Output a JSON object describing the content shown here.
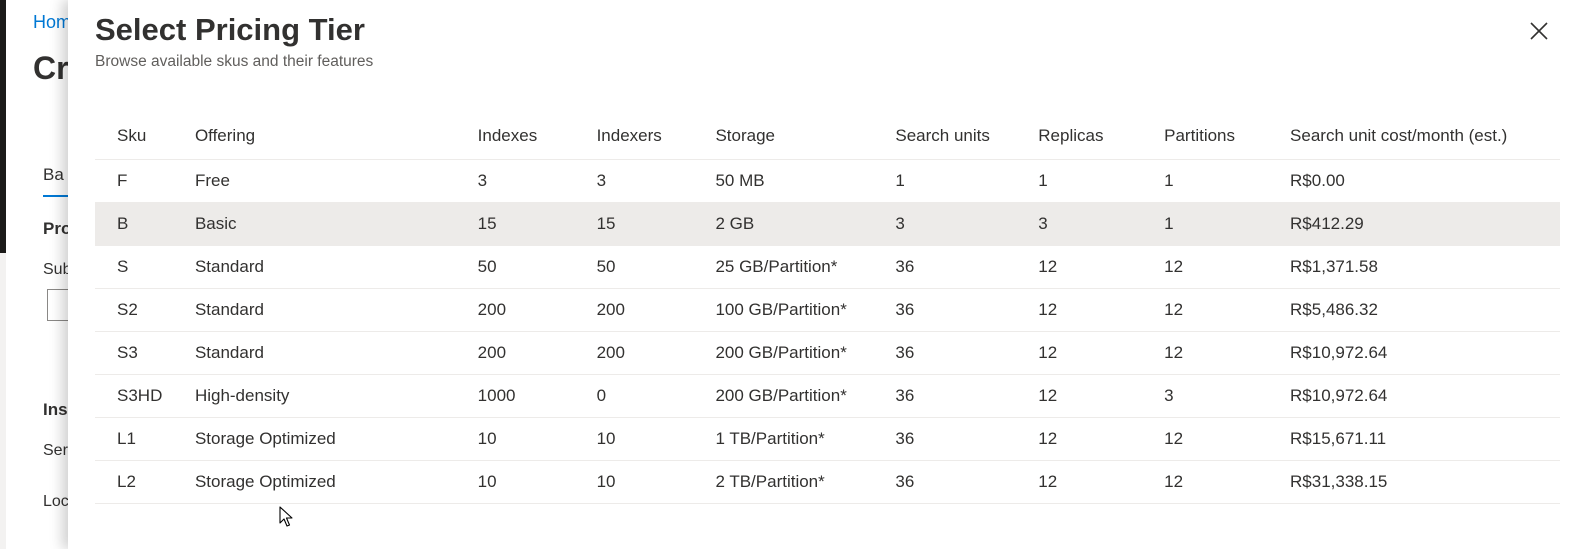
{
  "background": {
    "breadcrumb": "Hom",
    "title": "Cr",
    "tab_label": "Ba",
    "section_project": "Pro",
    "label_subscription": "Sub",
    "section_instance": "Ins",
    "label_service": "Ser",
    "label_location": "Loc"
  },
  "blade": {
    "title": "Select Pricing Tier",
    "subtitle": "Browse available skus and their features",
    "close_icon": "close-icon"
  },
  "table": {
    "headers": {
      "sku": "Sku",
      "offering": "Offering",
      "indexes": "Indexes",
      "indexers": "Indexers",
      "storage": "Storage",
      "search_units": "Search units",
      "replicas": "Replicas",
      "partitions": "Partitions",
      "cost": "Search unit cost/month (est.)"
    },
    "rows": [
      {
        "sku": "F",
        "offering": "Free",
        "indexes": "3",
        "indexers": "3",
        "storage": "50 MB",
        "search_units": "1",
        "replicas": "1",
        "partitions": "1",
        "cost": "R$0.00"
      },
      {
        "sku": "B",
        "offering": "Basic",
        "indexes": "15",
        "indexers": "15",
        "storage": "2 GB",
        "search_units": "3",
        "replicas": "3",
        "partitions": "1",
        "cost": "R$412.29"
      },
      {
        "sku": "S",
        "offering": "Standard",
        "indexes": "50",
        "indexers": "50",
        "storage": "25 GB/Partition*",
        "search_units": "36",
        "replicas": "12",
        "partitions": "12",
        "cost": "R$1,371.58"
      },
      {
        "sku": "S2",
        "offering": "Standard",
        "indexes": "200",
        "indexers": "200",
        "storage": "100 GB/Partition*",
        "search_units": "36",
        "replicas": "12",
        "partitions": "12",
        "cost": "R$5,486.32"
      },
      {
        "sku": "S3",
        "offering": "Standard",
        "indexes": "200",
        "indexers": "200",
        "storage": "200 GB/Partition*",
        "search_units": "36",
        "replicas": "12",
        "partitions": "12",
        "cost": "R$10,972.64"
      },
      {
        "sku": "S3HD",
        "offering": "High-density",
        "indexes": "1000",
        "indexers": "0",
        "storage": "200 GB/Partition*",
        "search_units": "36",
        "replicas": "12",
        "partitions": "3",
        "cost": "R$10,972.64"
      },
      {
        "sku": "L1",
        "offering": "Storage Optimized",
        "indexes": "10",
        "indexers": "10",
        "storage": "1 TB/Partition*",
        "search_units": "36",
        "replicas": "12",
        "partitions": "12",
        "cost": "R$15,671.11"
      },
      {
        "sku": "L2",
        "offering": "Storage Optimized",
        "indexes": "10",
        "indexers": "10",
        "storage": "2 TB/Partition*",
        "search_units": "36",
        "replicas": "12",
        "partitions": "12",
        "cost": "R$31,338.15"
      }
    ]
  },
  "colors": {
    "accent": "#0078d4",
    "selected_row": "#edebe9",
    "text": "#323130",
    "subtle_text": "#605e5c"
  }
}
